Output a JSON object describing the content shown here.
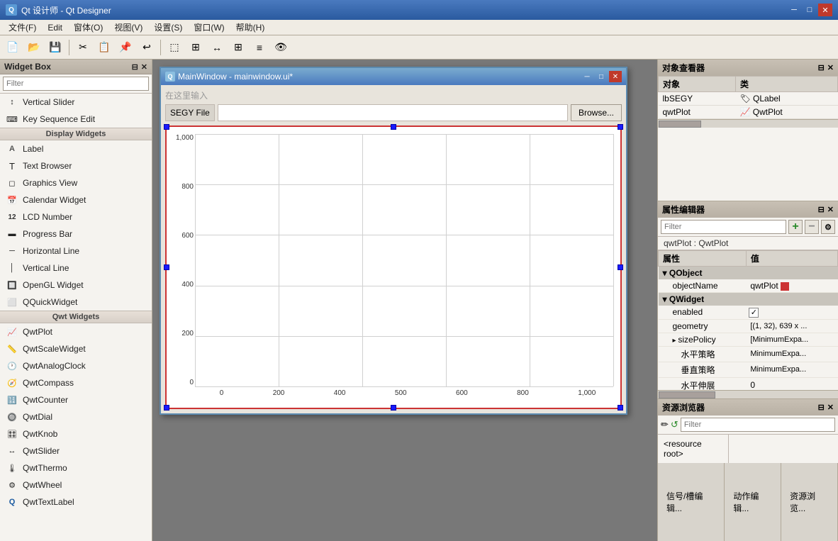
{
  "app": {
    "title": "Qt 设计师 - Qt Designer",
    "icon_label": "Qt"
  },
  "title_bar": {
    "title": "Qt 设计师 - Qt Designer",
    "minimize": "─",
    "maximize": "□",
    "close": "✕"
  },
  "menu": {
    "items": [
      "文件(F)",
      "Edit",
      "窗体(O)",
      "视图(V)",
      "设置(S)",
      "窗口(W)",
      "帮助(H)"
    ]
  },
  "widget_box": {
    "title": "Widget Box",
    "filter_placeholder": "Filter",
    "items": [
      {
        "type": "item",
        "icon": "↕",
        "label": "Vertical Slider"
      },
      {
        "type": "item",
        "icon": "⌨",
        "label": "Key Sequence Edit"
      },
      {
        "type": "category",
        "label": "Display Widgets"
      },
      {
        "type": "item",
        "icon": "A",
        "label": "Label"
      },
      {
        "type": "item",
        "icon": "T",
        "label": "Text Browser"
      },
      {
        "type": "item",
        "icon": "◻",
        "label": "Graphics View"
      },
      {
        "type": "item",
        "icon": "📅",
        "label": "Calendar Widget"
      },
      {
        "type": "item",
        "icon": "🔢",
        "label": "LCD Number"
      },
      {
        "type": "item",
        "icon": "▬",
        "label": "Progress Bar"
      },
      {
        "type": "item",
        "icon": "─",
        "label": "Horizontal Line"
      },
      {
        "type": "item",
        "icon": "│",
        "label": "Vertical Line"
      },
      {
        "type": "item",
        "icon": "🎮",
        "label": "OpenGL Widget"
      },
      {
        "type": "item",
        "icon": "⬜",
        "label": "QQuickWidget"
      },
      {
        "type": "category",
        "label": "Qwt Widgets"
      },
      {
        "type": "item",
        "icon": "📈",
        "label": "QwtPlot"
      },
      {
        "type": "item",
        "icon": "📏",
        "label": "QwtScaleWidget"
      },
      {
        "type": "item",
        "icon": "🕐",
        "label": "QwtAnalogClock"
      },
      {
        "type": "item",
        "icon": "🧭",
        "label": "QwtCompass"
      },
      {
        "type": "item",
        "icon": "🔢",
        "label": "QwtCounter"
      },
      {
        "type": "item",
        "icon": "🔘",
        "label": "QwtDial"
      },
      {
        "type": "item",
        "icon": "🎛",
        "label": "QwtKnob"
      },
      {
        "type": "item",
        "icon": "↔",
        "label": "QwtSlider"
      },
      {
        "type": "item",
        "icon": "🌡",
        "label": "QwtThermo"
      },
      {
        "type": "item",
        "icon": "⚙",
        "label": "QwtWheel"
      },
      {
        "type": "item",
        "icon": "T",
        "label": "QwtTextLabel"
      }
    ]
  },
  "main_window": {
    "title": "MainWindow - mainwindow.ui*",
    "placeholder_text": "在这里输入",
    "segy_label": "SEGY File",
    "browse_btn": "Browse...",
    "plot": {
      "y_axis": [
        "1,000",
        "800",
        "600",
        "400",
        "200",
        "0"
      ],
      "x_axis": [
        "0",
        "200",
        "400",
        "500",
        "600",
        "800",
        "1,000"
      ]
    }
  },
  "object_inspector": {
    "title": "对象查看器",
    "col_object": "对象",
    "col_class": "类",
    "rows": [
      {
        "object": "lbSEGY",
        "class_icon": "🏷",
        "class": "QLabel"
      },
      {
        "object": "qwtPlot",
        "class_icon": "📈",
        "class": "QwtPlot"
      }
    ]
  },
  "property_editor": {
    "title": "属性编辑器",
    "filter_placeholder": "Filter",
    "add_btn": "+",
    "remove_btn": "−",
    "config_btn": "⚙",
    "object_label": "qwtPlot : QwtPlot",
    "col_property": "属性",
    "col_value": "值",
    "sections": [
      {
        "name": "QObject",
        "properties": [
          {
            "name": "objectName",
            "indent": true,
            "value": "qwtPlot",
            "has_red": true
          }
        ]
      },
      {
        "name": "QWidget",
        "properties": [
          {
            "name": "enabled",
            "indent": true,
            "value": "✓",
            "type": "check"
          },
          {
            "name": "geometry",
            "indent": true,
            "value": "[(1, 32), 639 x ..."
          },
          {
            "name": "sizePolicy",
            "indent": true,
            "value": "[MinimumExpa..."
          },
          {
            "name": "水平策略",
            "indent": true,
            "value": "MinimumExpa..."
          },
          {
            "name": "垂直策略",
            "indent": true,
            "value": "MinimumExpa..."
          },
          {
            "name": "水平伸展",
            "indent": true,
            "value": "0"
          }
        ]
      }
    ]
  },
  "resource_browser": {
    "title": "资源浏览器",
    "filter_placeholder": "Filter",
    "tree_item": "<resource root>",
    "edit_icon": "✏",
    "refresh_icon": "↺"
  },
  "bottom_tabs": [
    {
      "label": "信号/槽编辑..."
    },
    {
      "label": "动作编辑..."
    },
    {
      "label": "资源浏览..."
    }
  ]
}
